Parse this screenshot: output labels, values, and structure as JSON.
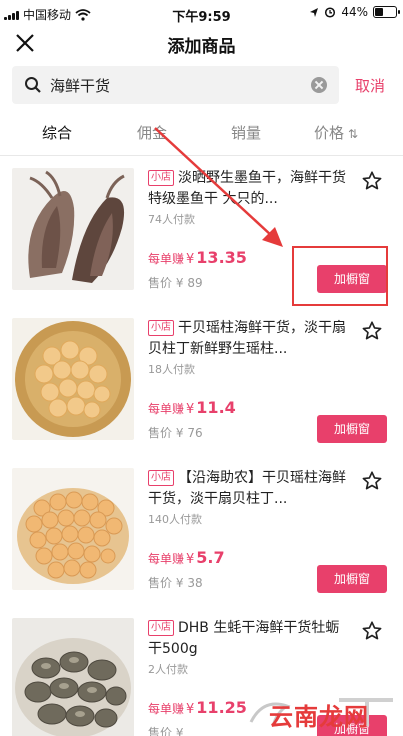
{
  "status_bar": {
    "carrier": "中国移动",
    "time": "下午9:59",
    "battery": "44%",
    "battery_level": 0.44,
    "icons": [
      "signal-icon",
      "wifi-icon",
      "location-icon",
      "alarm-icon",
      "battery-icon"
    ]
  },
  "header": {
    "title": "添加商品",
    "close_icon": "close-icon"
  },
  "search": {
    "value": "海鲜干货",
    "cancel_label": "取消"
  },
  "sort_tabs": [
    {
      "label": "综合",
      "active": true
    },
    {
      "label": "佣金",
      "active": false
    },
    {
      "label": "销量",
      "active": false
    },
    {
      "label": "价格",
      "active": false
    }
  ],
  "labels": {
    "shop_tag": "小店",
    "earn_prefix": "每单赚",
    "currency": "¥",
    "sale_prefix": "售价",
    "add_button": "加橱窗"
  },
  "products": [
    {
      "title": "淡晒野生墨鱼干，海鲜干货特级墨鱼干 大只的...",
      "sold": "74人付款",
      "earn": "13.35",
      "price": "89",
      "image": "dried-squid"
    },
    {
      "title": "干贝瑶柱海鲜干货，淡干扇贝柱丁新鲜野生瑶柱...",
      "sold": "18人付款",
      "earn": "11.4",
      "price": "76",
      "image": "dried-scallops-basket"
    },
    {
      "title": "【沿海助农】干贝瑶柱海鲜干货，淡干扇贝柱丁...",
      "sold": "140人付款",
      "earn": "5.7",
      "price": "38",
      "image": "dried-scallops-pile"
    },
    {
      "title": "DHB 生蚝干海鲜干货牡蛎干500g",
      "sold": "2人付款",
      "earn": "11.25",
      "price": "",
      "image": "dried-oysters"
    }
  ],
  "watermark": {
    "text": "云南龙网"
  },
  "colors": {
    "accent": "#e8406b",
    "annotation": "#e53b3b"
  }
}
